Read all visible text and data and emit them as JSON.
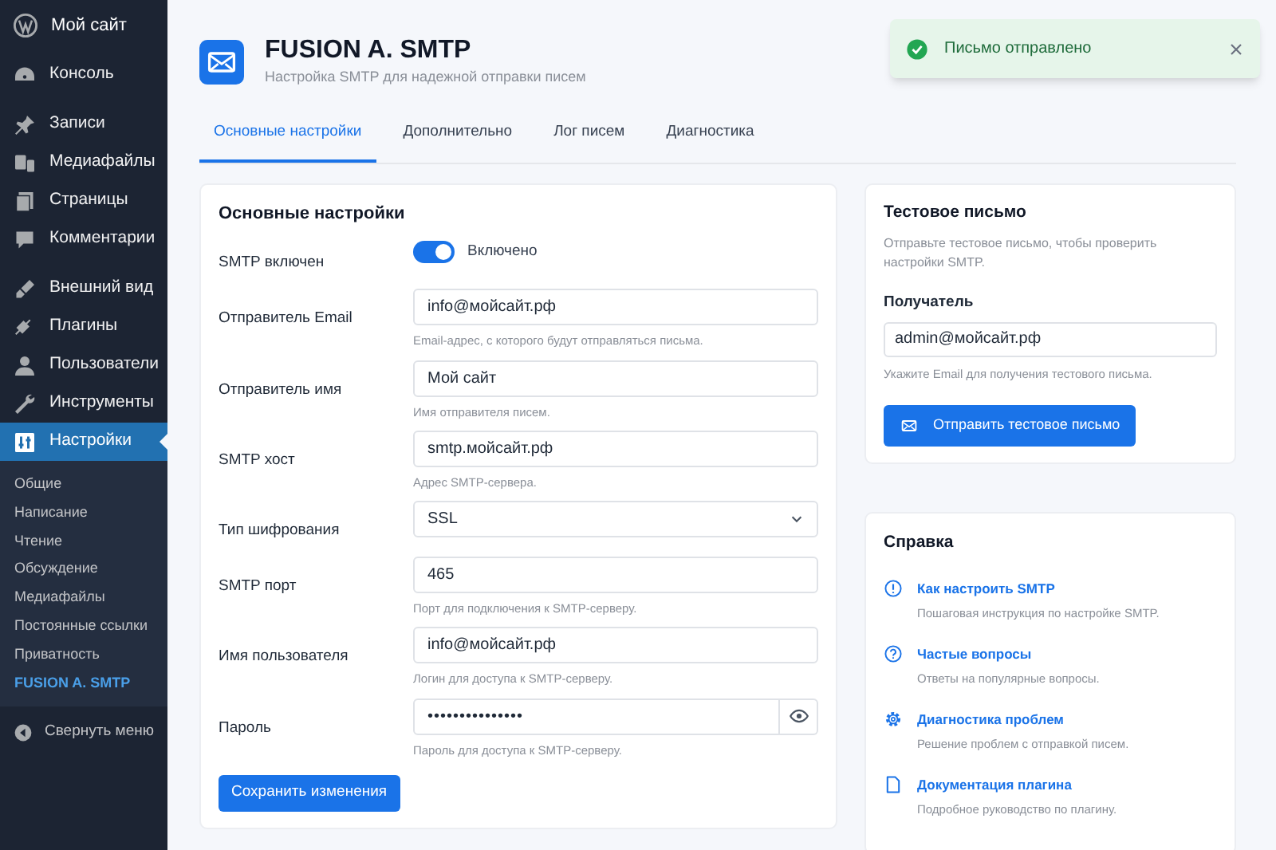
{
  "sidebar": {
    "site": "Мой сайт",
    "groups": [
      [
        {
          "label": "Консоль",
          "selected": false
        }
      ],
      [
        {
          "label": "Записи",
          "selected": false
        },
        {
          "label": "Медиафайлы",
          "selected": false
        },
        {
          "label": "Страницы",
          "selected": false
        },
        {
          "label": "Комментарии",
          "selected": false
        }
      ],
      [
        {
          "label": "Внешний вид",
          "selected": false
        },
        {
          "label": "Плагины",
          "selected": false
        },
        {
          "label": "Пользователи",
          "selected": false
        },
        {
          "label": "Инструменты",
          "selected": false
        },
        {
          "label": "Настройки",
          "selected": true
        }
      ]
    ],
    "submenu": [
      {
        "label": "Общие",
        "selected": false
      },
      {
        "label": "Написание",
        "selected": false
      },
      {
        "label": "Чтение",
        "selected": false
      },
      {
        "label": "Обсуждение",
        "selected": false
      },
      {
        "label": "Медиафайлы",
        "selected": false
      },
      {
        "label": "Постоянные ссылки",
        "selected": false
      },
      {
        "label": "Приватность",
        "selected": false
      },
      {
        "label": "FUSION A. SMTP",
        "selected": true
      }
    ],
    "collapse": "Свернуть меню"
  },
  "header": {
    "title": "FUSION A. SMTP",
    "subtitle": "Настройка SMTP для надежной отправки писем"
  },
  "tabs": [
    {
      "label": "Основные настройки",
      "selected": true
    },
    {
      "label": "Дополнительно",
      "selected": false
    },
    {
      "label": "Лог писем",
      "selected": false
    },
    {
      "label": "Диагностика",
      "selected": false
    }
  ],
  "toast": {
    "message": "Письмо отправлено"
  },
  "settings": {
    "title": "Основные настройки",
    "fields": [
      {
        "kind": "toggle",
        "label": "SMTP включен",
        "on": true,
        "value": "Включено"
      },
      {
        "kind": "text",
        "label": "Отправитель Email",
        "value": "info@мойсайт.рф",
        "help": "Email-адрес, с которого будут отправляться письма."
      },
      {
        "kind": "text",
        "label": "Отправитель имя",
        "value": "Мой сайт",
        "help": "Имя отправителя писем."
      },
      {
        "kind": "text",
        "label": "SMTP хост",
        "value": "smtp.мойсайт.рф",
        "help": "Адрес SMTP-сервера."
      },
      {
        "kind": "select",
        "label": "Тип шифрования",
        "value": "SSL"
      },
      {
        "kind": "text",
        "label": "SMTP порт",
        "value": "465",
        "help": "Порт для подключения к SMTP-серверу."
      },
      {
        "kind": "text",
        "label": "Имя пользователя",
        "value": "info@мойсайт.рф",
        "help": "Логин для доступа к SMTP-серверу."
      },
      {
        "kind": "password",
        "label": "Пароль",
        "value": "•••••••••••••••",
        "help": "Пароль для доступа к SMTP-серверу."
      }
    ],
    "save": "Сохранить изменения"
  },
  "test_email": {
    "title": "Тестовое письмо",
    "description": "Отправьте тестовое письмо, чтобы проверить настройки SMTP.",
    "recipient_label": "Получатель",
    "recipient": "admin@мойсайт.рф",
    "help": "Укажите Email для получения тестового письма.",
    "send": "Отправить тестовое письмо"
  },
  "help": {
    "title": "Справка",
    "items": [
      {
        "title": "Как настроить SMTP",
        "description": "Пошаговая инструкция по настройке SMTP."
      },
      {
        "title": "Частые вопросы",
        "description": "Ответы на популярные вопросы."
      },
      {
        "title": "Диагностика проблем",
        "description": "Решение проблем с отправкой писем."
      },
      {
        "title": "Документация плагина",
        "description": "Подробное руководство по плагину."
      }
    ]
  }
}
